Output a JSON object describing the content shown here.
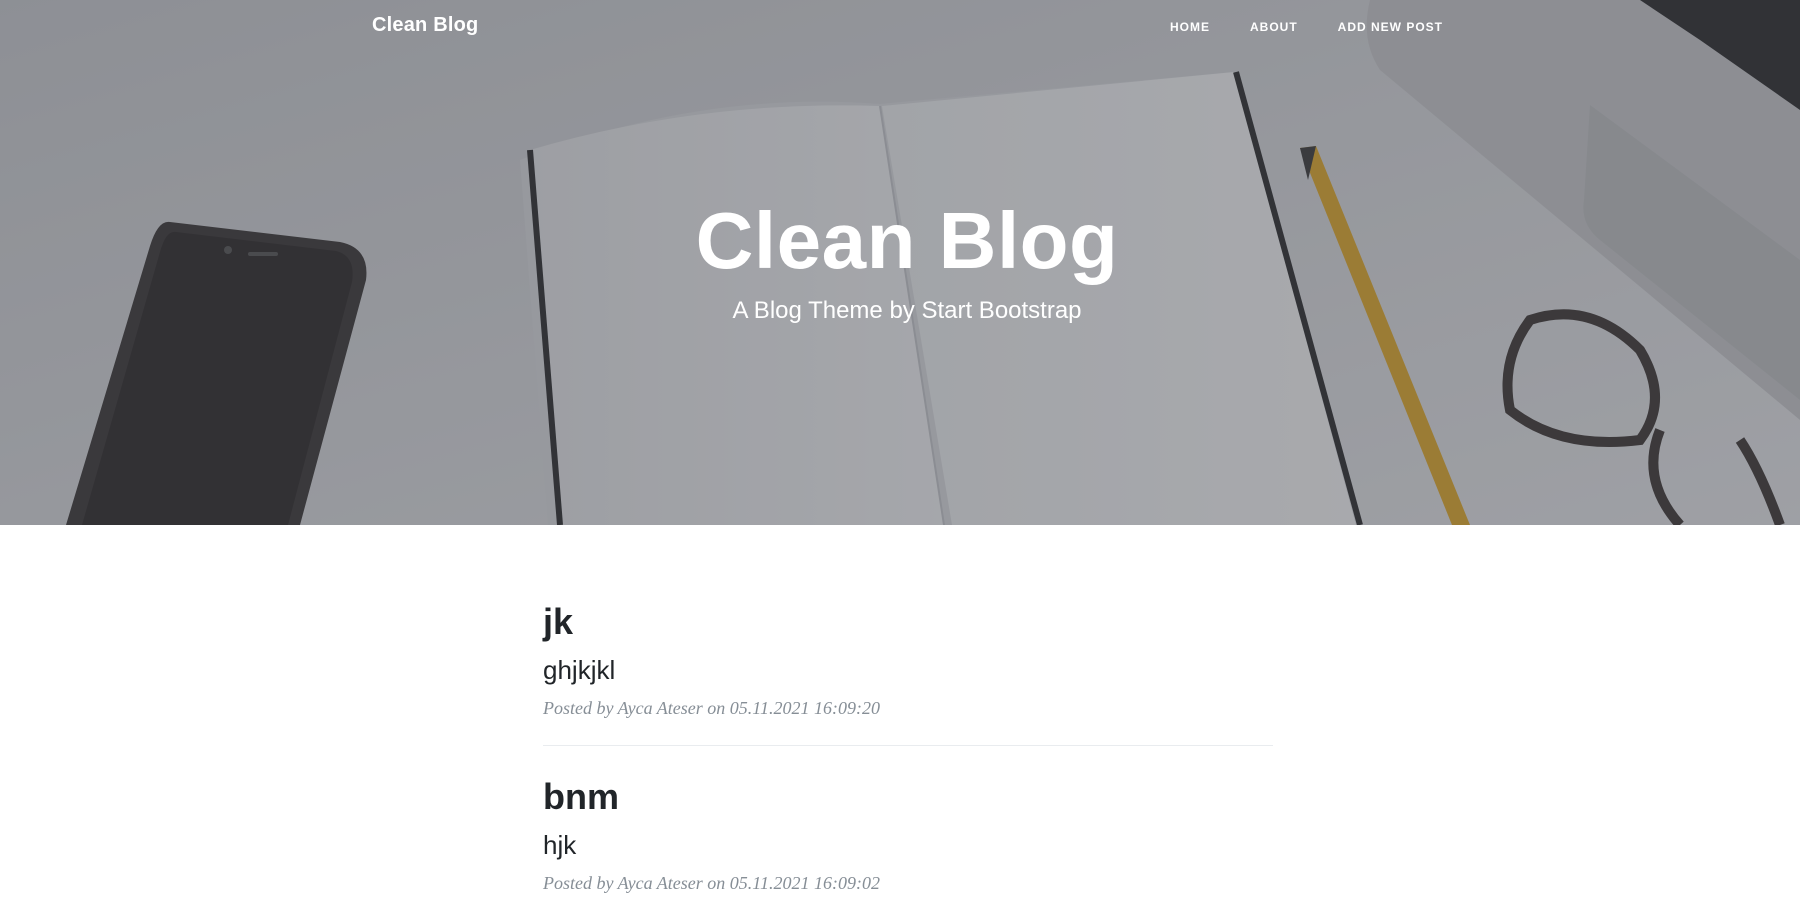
{
  "navbar": {
    "brand": "Clean Blog",
    "links": [
      {
        "label": "Home"
      },
      {
        "label": "About"
      },
      {
        "label": "Add New Post"
      }
    ]
  },
  "hero": {
    "title": "Clean Blog",
    "subtitle": "A Blog Theme by Start Bootstrap"
  },
  "posts": [
    {
      "title": "jk",
      "subtitle": "ghjkjkl",
      "meta": "Posted by Ayca Ateser on 05.11.2021 16:09:20"
    },
    {
      "title": "bnm",
      "subtitle": "hjk",
      "meta": "Posted by Ayca Ateser on 05.11.2021 16:09:02"
    }
  ],
  "colors": {
    "text": "#212529",
    "meta": "#868e96",
    "divider": "#e9ecef",
    "hero_overlay": "#3c3e46"
  }
}
